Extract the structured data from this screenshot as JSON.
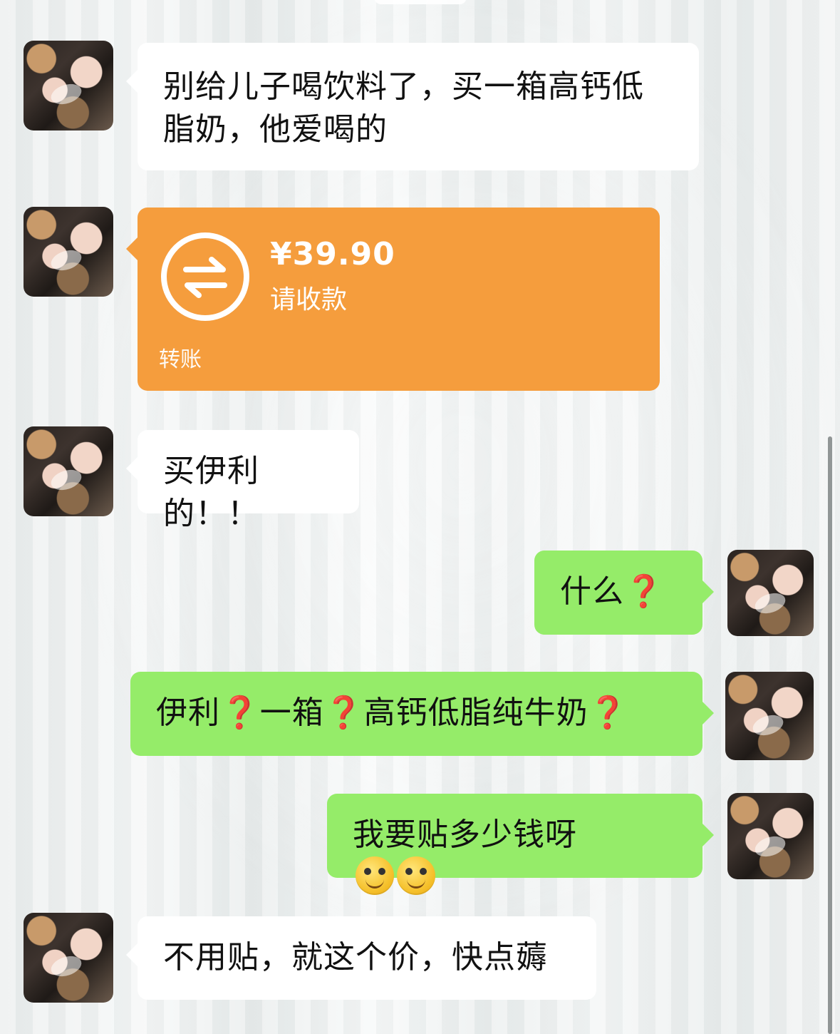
{
  "messages": [
    {
      "side": "left",
      "type": "text",
      "text": "别给儿子喝饮料了，买一箱高钙低\n脂奶，他爱喝的"
    },
    {
      "side": "left",
      "type": "transfer",
      "amount": "¥39.90",
      "status": "请收款",
      "footer": "转账",
      "icon": "transfer-arrows-icon",
      "color": "#f59d3d"
    },
    {
      "side": "left",
      "type": "text",
      "text": "买伊利的！！"
    },
    {
      "side": "right",
      "type": "text",
      "text": "什么❓"
    },
    {
      "side": "right",
      "type": "text",
      "text": "伊利❓一箱❓高钙低脂纯牛奶❓"
    },
    {
      "side": "right",
      "type": "text",
      "text": "我要贴多少钱呀"
    },
    {
      "side": "left",
      "type": "text",
      "text": "不用贴，就这个价，快点薅"
    }
  ],
  "theme": {
    "left_bubble": "#ffffff",
    "right_bubble": "#95ec69",
    "transfer_bubble": "#f59d3d"
  }
}
